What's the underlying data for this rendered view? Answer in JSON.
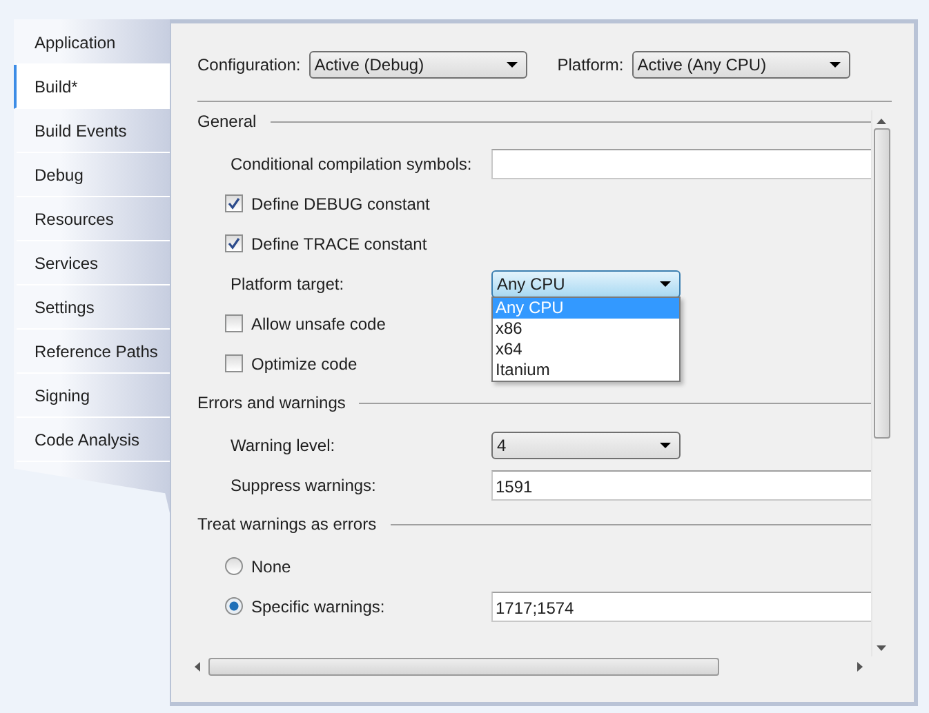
{
  "tabs": [
    {
      "label": "Application",
      "selected": false
    },
    {
      "label": "Build*",
      "selected": true
    },
    {
      "label": "Build Events",
      "selected": false
    },
    {
      "label": "Debug",
      "selected": false
    },
    {
      "label": "Resources",
      "selected": false
    },
    {
      "label": "Services",
      "selected": false
    },
    {
      "label": "Settings",
      "selected": false
    },
    {
      "label": "Reference Paths",
      "selected": false
    },
    {
      "label": "Signing",
      "selected": false
    },
    {
      "label": "Code Analysis",
      "selected": false
    }
  ],
  "configuration": {
    "label": "Configuration:",
    "value": "Active (Debug)"
  },
  "platform": {
    "label": "Platform:",
    "value": "Active (Any CPU)"
  },
  "sections": [
    {
      "title": "General",
      "rows": [
        {
          "kind": "text",
          "label": "Conditional compilation symbols:",
          "value": ""
        },
        {
          "kind": "checkbox",
          "label": "Define DEBUG constant",
          "checked": true
        },
        {
          "kind": "checkbox",
          "label": "Define TRACE constant",
          "checked": true
        },
        {
          "kind": "dropdown",
          "label": "Platform target:",
          "value": "Any CPU",
          "open": true,
          "options": [
            {
              "label": "Any CPU",
              "selected": true
            },
            {
              "label": "x86",
              "selected": false
            },
            {
              "label": "x64",
              "selected": false
            },
            {
              "label": "Itanium",
              "selected": false
            }
          ]
        },
        {
          "kind": "checkbox",
          "label": "Allow unsafe code",
          "checked": false
        },
        {
          "kind": "checkbox",
          "label": "Optimize code",
          "checked": false
        }
      ]
    },
    {
      "title": "Errors and warnings",
      "rows": [
        {
          "kind": "dropdown",
          "label": "Warning level:",
          "value": "4",
          "open": false
        },
        {
          "kind": "text",
          "label": "Suppress warnings:",
          "value": "1591"
        }
      ]
    },
    {
      "title": "Treat warnings as errors",
      "rows": [
        {
          "kind": "radio",
          "label": "None",
          "selected": false
        },
        {
          "kind": "radio",
          "label": "Specific warnings:",
          "selected": true,
          "value": "1717;1574"
        }
      ]
    }
  ]
}
